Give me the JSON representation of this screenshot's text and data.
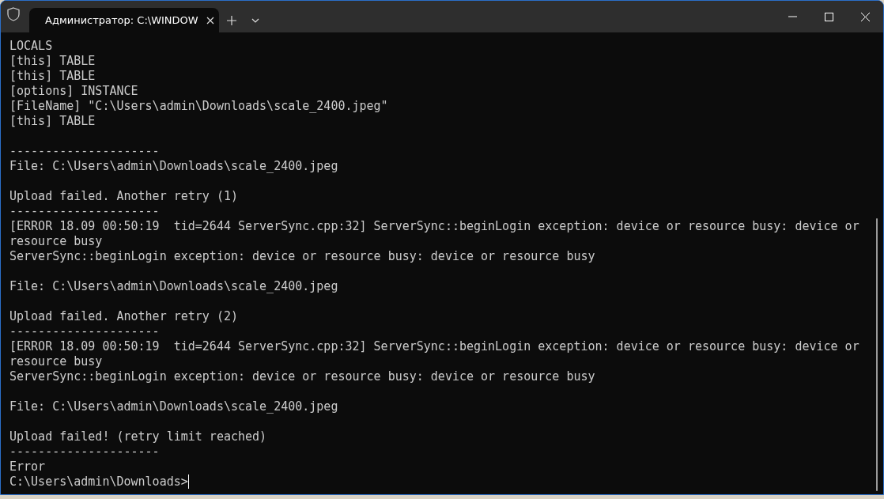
{
  "window": {
    "tab_title": "Администратор: C:\\WINDOW"
  },
  "lines": [
    {
      "kind": "text",
      "text": "LOCALS"
    },
    {
      "kind": "text",
      "text": "[this] TABLE"
    },
    {
      "kind": "text",
      "text": "[this] TABLE"
    },
    {
      "kind": "text",
      "text": "[options] INSTANCE"
    },
    {
      "kind": "text",
      "text": "[FileName] \"C:\\Users\\admin\\Downloads\\scale_2400.jpeg\""
    },
    {
      "kind": "text",
      "text": "[this] TABLE"
    },
    {
      "kind": "blank"
    },
    {
      "kind": "text",
      "text": "---------------------"
    },
    {
      "kind": "text",
      "text": "File: C:\\Users\\admin\\Downloads\\scale_2400.jpeg"
    },
    {
      "kind": "blank"
    },
    {
      "kind": "text",
      "text": "Upload failed. Another retry (1)"
    },
    {
      "kind": "text",
      "text": "---------------------"
    },
    {
      "kind": "text",
      "text": "[ERROR 18.09 00:50:19  tid=2644 ServerSync.cpp:32] ServerSync::beginLogin exception: device or resource busy: device or"
    },
    {
      "kind": "text",
      "text": "resource busy"
    },
    {
      "kind": "text",
      "text": "ServerSync::beginLogin exception: device or resource busy: device or resource busy"
    },
    {
      "kind": "blank"
    },
    {
      "kind": "text",
      "text": "File: C:\\Users\\admin\\Downloads\\scale_2400.jpeg"
    },
    {
      "kind": "blank"
    },
    {
      "kind": "text",
      "text": "Upload failed. Another retry (2)"
    },
    {
      "kind": "text",
      "text": "---------------------"
    },
    {
      "kind": "text",
      "text": "[ERROR 18.09 00:50:19  tid=2644 ServerSync.cpp:32] ServerSync::beginLogin exception: device or resource busy: device or"
    },
    {
      "kind": "text",
      "text": "resource busy"
    },
    {
      "kind": "text",
      "text": "ServerSync::beginLogin exception: device or resource busy: device or resource busy"
    },
    {
      "kind": "blank"
    },
    {
      "kind": "text",
      "text": "File: C:\\Users\\admin\\Downloads\\scale_2400.jpeg"
    },
    {
      "kind": "blank"
    },
    {
      "kind": "text",
      "text": "Upload failed! (retry limit reached)"
    },
    {
      "kind": "text",
      "text": "---------------------"
    },
    {
      "kind": "text",
      "text": "Error"
    },
    {
      "kind": "prompt",
      "text": "C:\\Users\\admin\\Downloads>"
    }
  ]
}
